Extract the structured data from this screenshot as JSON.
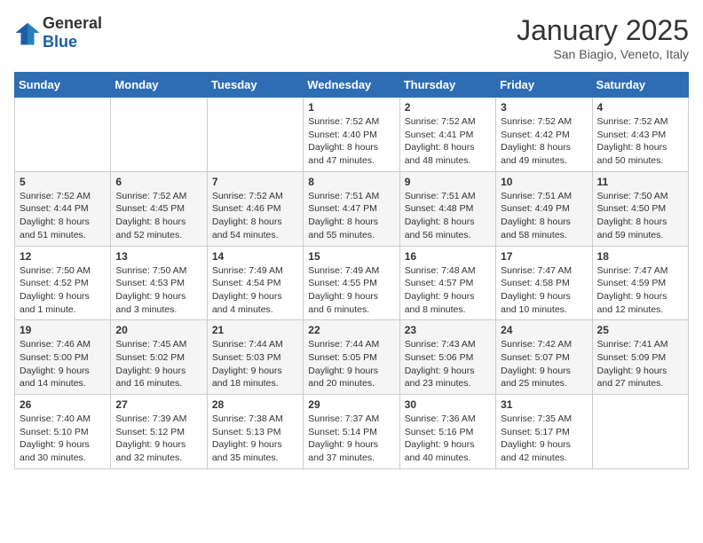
{
  "logo": {
    "general": "General",
    "blue": "Blue"
  },
  "header": {
    "month": "January 2025",
    "location": "San Biagio, Veneto, Italy"
  },
  "weekdays": [
    "Sunday",
    "Monday",
    "Tuesday",
    "Wednesday",
    "Thursday",
    "Friday",
    "Saturday"
  ],
  "weeks": [
    [
      {
        "day": "",
        "info": ""
      },
      {
        "day": "",
        "info": ""
      },
      {
        "day": "",
        "info": ""
      },
      {
        "day": "1",
        "info": "Sunrise: 7:52 AM\nSunset: 4:40 PM\nDaylight: 8 hours and 47 minutes."
      },
      {
        "day": "2",
        "info": "Sunrise: 7:52 AM\nSunset: 4:41 PM\nDaylight: 8 hours and 48 minutes."
      },
      {
        "day": "3",
        "info": "Sunrise: 7:52 AM\nSunset: 4:42 PM\nDaylight: 8 hours and 49 minutes."
      },
      {
        "day": "4",
        "info": "Sunrise: 7:52 AM\nSunset: 4:43 PM\nDaylight: 8 hours and 50 minutes."
      }
    ],
    [
      {
        "day": "5",
        "info": "Sunrise: 7:52 AM\nSunset: 4:44 PM\nDaylight: 8 hours and 51 minutes."
      },
      {
        "day": "6",
        "info": "Sunrise: 7:52 AM\nSunset: 4:45 PM\nDaylight: 8 hours and 52 minutes."
      },
      {
        "day": "7",
        "info": "Sunrise: 7:52 AM\nSunset: 4:46 PM\nDaylight: 8 hours and 54 minutes."
      },
      {
        "day": "8",
        "info": "Sunrise: 7:51 AM\nSunset: 4:47 PM\nDaylight: 8 hours and 55 minutes."
      },
      {
        "day": "9",
        "info": "Sunrise: 7:51 AM\nSunset: 4:48 PM\nDaylight: 8 hours and 56 minutes."
      },
      {
        "day": "10",
        "info": "Sunrise: 7:51 AM\nSunset: 4:49 PM\nDaylight: 8 hours and 58 minutes."
      },
      {
        "day": "11",
        "info": "Sunrise: 7:50 AM\nSunset: 4:50 PM\nDaylight: 8 hours and 59 minutes."
      }
    ],
    [
      {
        "day": "12",
        "info": "Sunrise: 7:50 AM\nSunset: 4:52 PM\nDaylight: 9 hours and 1 minute."
      },
      {
        "day": "13",
        "info": "Sunrise: 7:50 AM\nSunset: 4:53 PM\nDaylight: 9 hours and 3 minutes."
      },
      {
        "day": "14",
        "info": "Sunrise: 7:49 AM\nSunset: 4:54 PM\nDaylight: 9 hours and 4 minutes."
      },
      {
        "day": "15",
        "info": "Sunrise: 7:49 AM\nSunset: 4:55 PM\nDaylight: 9 hours and 6 minutes."
      },
      {
        "day": "16",
        "info": "Sunrise: 7:48 AM\nSunset: 4:57 PM\nDaylight: 9 hours and 8 minutes."
      },
      {
        "day": "17",
        "info": "Sunrise: 7:47 AM\nSunset: 4:58 PM\nDaylight: 9 hours and 10 minutes."
      },
      {
        "day": "18",
        "info": "Sunrise: 7:47 AM\nSunset: 4:59 PM\nDaylight: 9 hours and 12 minutes."
      }
    ],
    [
      {
        "day": "19",
        "info": "Sunrise: 7:46 AM\nSunset: 5:00 PM\nDaylight: 9 hours and 14 minutes."
      },
      {
        "day": "20",
        "info": "Sunrise: 7:45 AM\nSunset: 5:02 PM\nDaylight: 9 hours and 16 minutes."
      },
      {
        "day": "21",
        "info": "Sunrise: 7:44 AM\nSunset: 5:03 PM\nDaylight: 9 hours and 18 minutes."
      },
      {
        "day": "22",
        "info": "Sunrise: 7:44 AM\nSunset: 5:05 PM\nDaylight: 9 hours and 20 minutes."
      },
      {
        "day": "23",
        "info": "Sunrise: 7:43 AM\nSunset: 5:06 PM\nDaylight: 9 hours and 23 minutes."
      },
      {
        "day": "24",
        "info": "Sunrise: 7:42 AM\nSunset: 5:07 PM\nDaylight: 9 hours and 25 minutes."
      },
      {
        "day": "25",
        "info": "Sunrise: 7:41 AM\nSunset: 5:09 PM\nDaylight: 9 hours and 27 minutes."
      }
    ],
    [
      {
        "day": "26",
        "info": "Sunrise: 7:40 AM\nSunset: 5:10 PM\nDaylight: 9 hours and 30 minutes."
      },
      {
        "day": "27",
        "info": "Sunrise: 7:39 AM\nSunset: 5:12 PM\nDaylight: 9 hours and 32 minutes."
      },
      {
        "day": "28",
        "info": "Sunrise: 7:38 AM\nSunset: 5:13 PM\nDaylight: 9 hours and 35 minutes."
      },
      {
        "day": "29",
        "info": "Sunrise: 7:37 AM\nSunset: 5:14 PM\nDaylight: 9 hours and 37 minutes."
      },
      {
        "day": "30",
        "info": "Sunrise: 7:36 AM\nSunset: 5:16 PM\nDaylight: 9 hours and 40 minutes."
      },
      {
        "day": "31",
        "info": "Sunrise: 7:35 AM\nSunset: 5:17 PM\nDaylight: 9 hours and 42 minutes."
      },
      {
        "day": "",
        "info": ""
      }
    ]
  ]
}
